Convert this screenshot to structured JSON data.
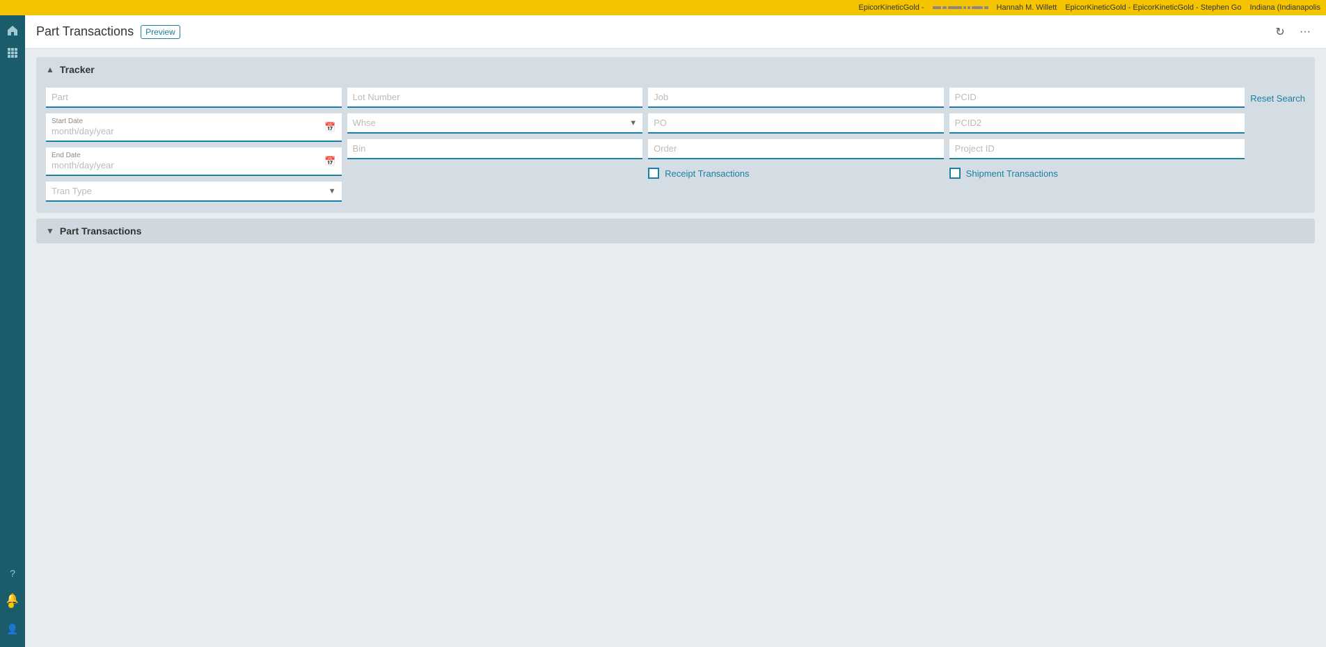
{
  "topBar": {
    "items": [
      "EpicorKineticGold -",
      "Hannah M. Willett",
      "EpicorKineticGold - EpicorKineticGold - Stephen Go",
      "Indiana (Indianapolis"
    ]
  },
  "pageHeader": {
    "title": "Part Transactions",
    "preview": "Preview",
    "refreshLabel": "refresh",
    "moreLabel": "more options"
  },
  "tracker": {
    "sectionLabel": "Tracker",
    "fields": {
      "part": {
        "placeholder": "Part"
      },
      "lotNumber": {
        "placeholder": "Lot Number"
      },
      "job": {
        "placeholder": "Job"
      },
      "pcid": {
        "placeholder": "PCID"
      },
      "startDate": {
        "label": "Start Date",
        "placeholder": "month/day/year"
      },
      "whse": {
        "placeholder": "Whse"
      },
      "po": {
        "placeholder": "PO"
      },
      "pcid2": {
        "placeholder": "PCID2"
      },
      "endDate": {
        "label": "End Date",
        "placeholder": "month/day/year"
      },
      "bin": {
        "placeholder": "Bin"
      },
      "order": {
        "placeholder": "Order"
      },
      "projectId": {
        "placeholder": "Project ID"
      },
      "tranType": {
        "placeholder": "Tran Type"
      }
    },
    "checkboxes": {
      "receiptTransactions": {
        "label": "Receipt Transactions",
        "checked": false
      },
      "shipmentTransactions": {
        "label": "Shipment Transactions",
        "checked": false
      }
    },
    "resetSearch": "Reset Search"
  },
  "partTransactions": {
    "sectionLabel": "Part Transactions"
  },
  "sidebar": {
    "homeLabel": "Home",
    "appsLabel": "Apps",
    "helpLabel": "Help",
    "notificationsLabel": "Notifications",
    "userLabel": "User"
  }
}
